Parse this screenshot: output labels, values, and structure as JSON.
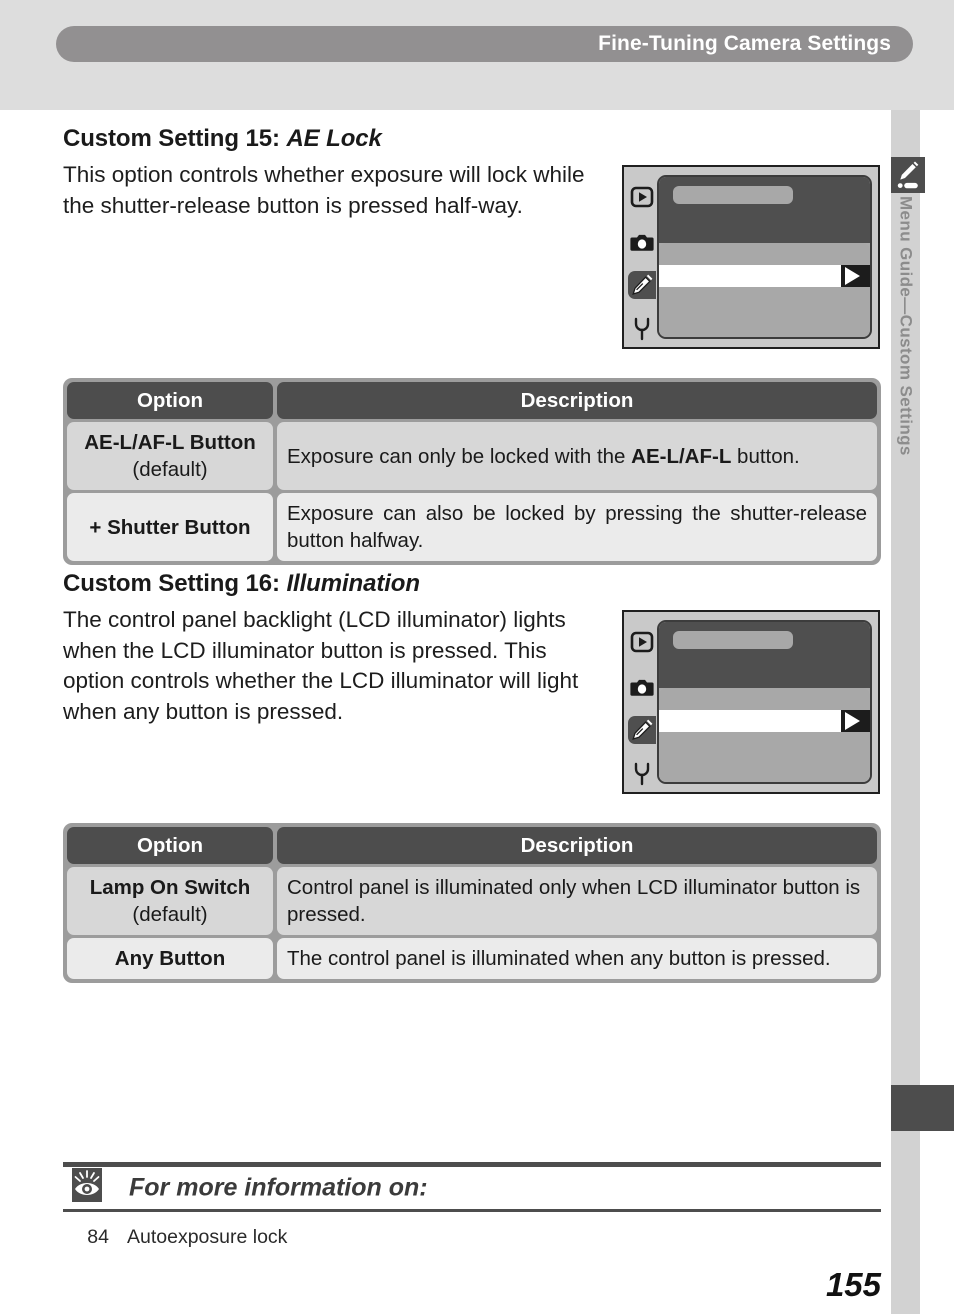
{
  "header": {
    "title": "Fine-Tuning Camera Settings"
  },
  "side_tab": {
    "label": "Menu Guide—Custom Settings",
    "icon": "pencil-slider-icon"
  },
  "sections": [
    {
      "title_prefix": "Custom Setting 15: ",
      "title_italic": "AE Lock",
      "body": "This option controls whether exposure will lock while the shutter-release button is pressed half-way.",
      "lcd": {
        "icons": [
          "playback-icon",
          "shooting-menu-icon",
          "custom-settings-icon",
          "setup-wrench-icon"
        ],
        "selected_icon_index": 2
      },
      "table": {
        "columns": [
          "Option",
          "Description"
        ],
        "rows": [
          {
            "option": "AE-L/AF-L Button",
            "option_sub": "(default)",
            "description": "Exposure can only be locked with the AE-L/AF-L button.",
            "description_bold": "AE-L/AF-L"
          },
          {
            "option": "+ Shutter Button",
            "option_sub": "",
            "description": "Exposure can also be locked by pressing the shutter-release button halfway.",
            "description_bold": ""
          }
        ]
      }
    },
    {
      "title_prefix": "Custom Setting 16: ",
      "title_italic": "Illumination",
      "body": "The control panel backlight (LCD illuminator) lights when the LCD illuminator button is pressed.  This option controls whether the LCD illuminator will light when any button is pressed.",
      "lcd": {
        "icons": [
          "playback-icon",
          "shooting-menu-icon",
          "custom-settings-icon",
          "setup-wrench-icon"
        ],
        "selected_icon_index": 2
      },
      "table": {
        "columns": [
          "Option",
          "Description"
        ],
        "rows": [
          {
            "option": "Lamp On Switch",
            "option_sub": "(default)",
            "description": "Control panel is illuminated only when LCD illuminator button is pressed.",
            "description_bold": ""
          },
          {
            "option": "Any Button",
            "option_sub": "",
            "description": "The control panel is illuminated when any button is pressed.",
            "description_bold": ""
          }
        ]
      }
    }
  ],
  "footer": {
    "icon": "eye-icon",
    "heading": "For more information on:",
    "references": [
      {
        "page": "84",
        "text": "Autoexposure lock"
      }
    ],
    "page_number": "155"
  }
}
